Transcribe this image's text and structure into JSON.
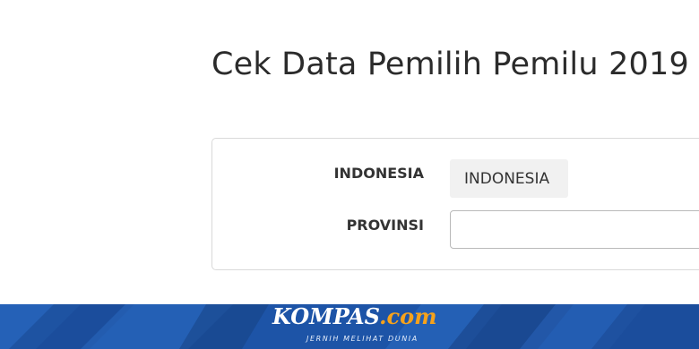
{
  "page": {
    "title": "Cek Data Pemilih Pemilu 2019"
  },
  "form": {
    "country_label": "INDONESIA",
    "country_value": "INDONESIA",
    "province_label": "PROVINSI",
    "province_value": ""
  },
  "watermark": {
    "brand_main": "KOMPAS",
    "brand_suffix": ".com",
    "tagline": "JERNIH MELIHAT DUNIA"
  },
  "colors": {
    "footer_band": "#1d54a7",
    "brand_accent": "#f6a21b"
  }
}
